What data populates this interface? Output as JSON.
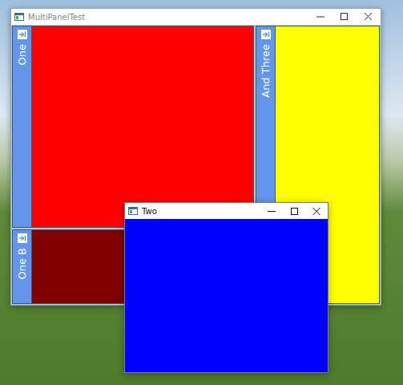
{
  "main_window": {
    "title": "MultiPanelTest",
    "columns": [
      {
        "panels": [
          {
            "label": "One",
            "color": "#ff0000"
          },
          {
            "label": "One B",
            "color": "#800000"
          }
        ]
      },
      {
        "panels": [
          {
            "label": "And Three",
            "color": "#ffff00"
          }
        ]
      }
    ]
  },
  "child_window": {
    "title": "Two",
    "color": "#0000ff"
  }
}
